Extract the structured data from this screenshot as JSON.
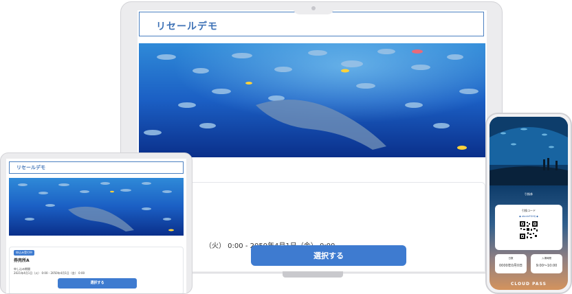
{
  "laptop": {
    "title": "リセールデモ",
    "date_range_fragment": "（火） 0:00 - 2050年4月1日（金） 0:00",
    "select_button": "選択する"
  },
  "tablet": {
    "title": "リセールデモ",
    "status_badge": "申込み受付中",
    "ticket_name": "券売所A",
    "period_label": "申し込み期間",
    "period": "2021年4月1日（火） 0:00 - 2050年4月1日（金） 0:00",
    "select_button": "選択する"
  },
  "phone": {
    "tab_label": "引換券",
    "code_label": "引換コード",
    "code_value": "◆ abcdeFGHIJ ◆",
    "box1_label": "日数",
    "box1_value": "0000年0月0日",
    "box2_label": "入場時間",
    "box2_value": "9:00〜10:00",
    "brand": "CLOUD PASS"
  },
  "colors": {
    "accent": "#3e7bd0",
    "title": "#3e72b6",
    "ocean": "#0a4fb8"
  },
  "icons": [
    "aquarium-photo",
    "qr-code-icon"
  ]
}
